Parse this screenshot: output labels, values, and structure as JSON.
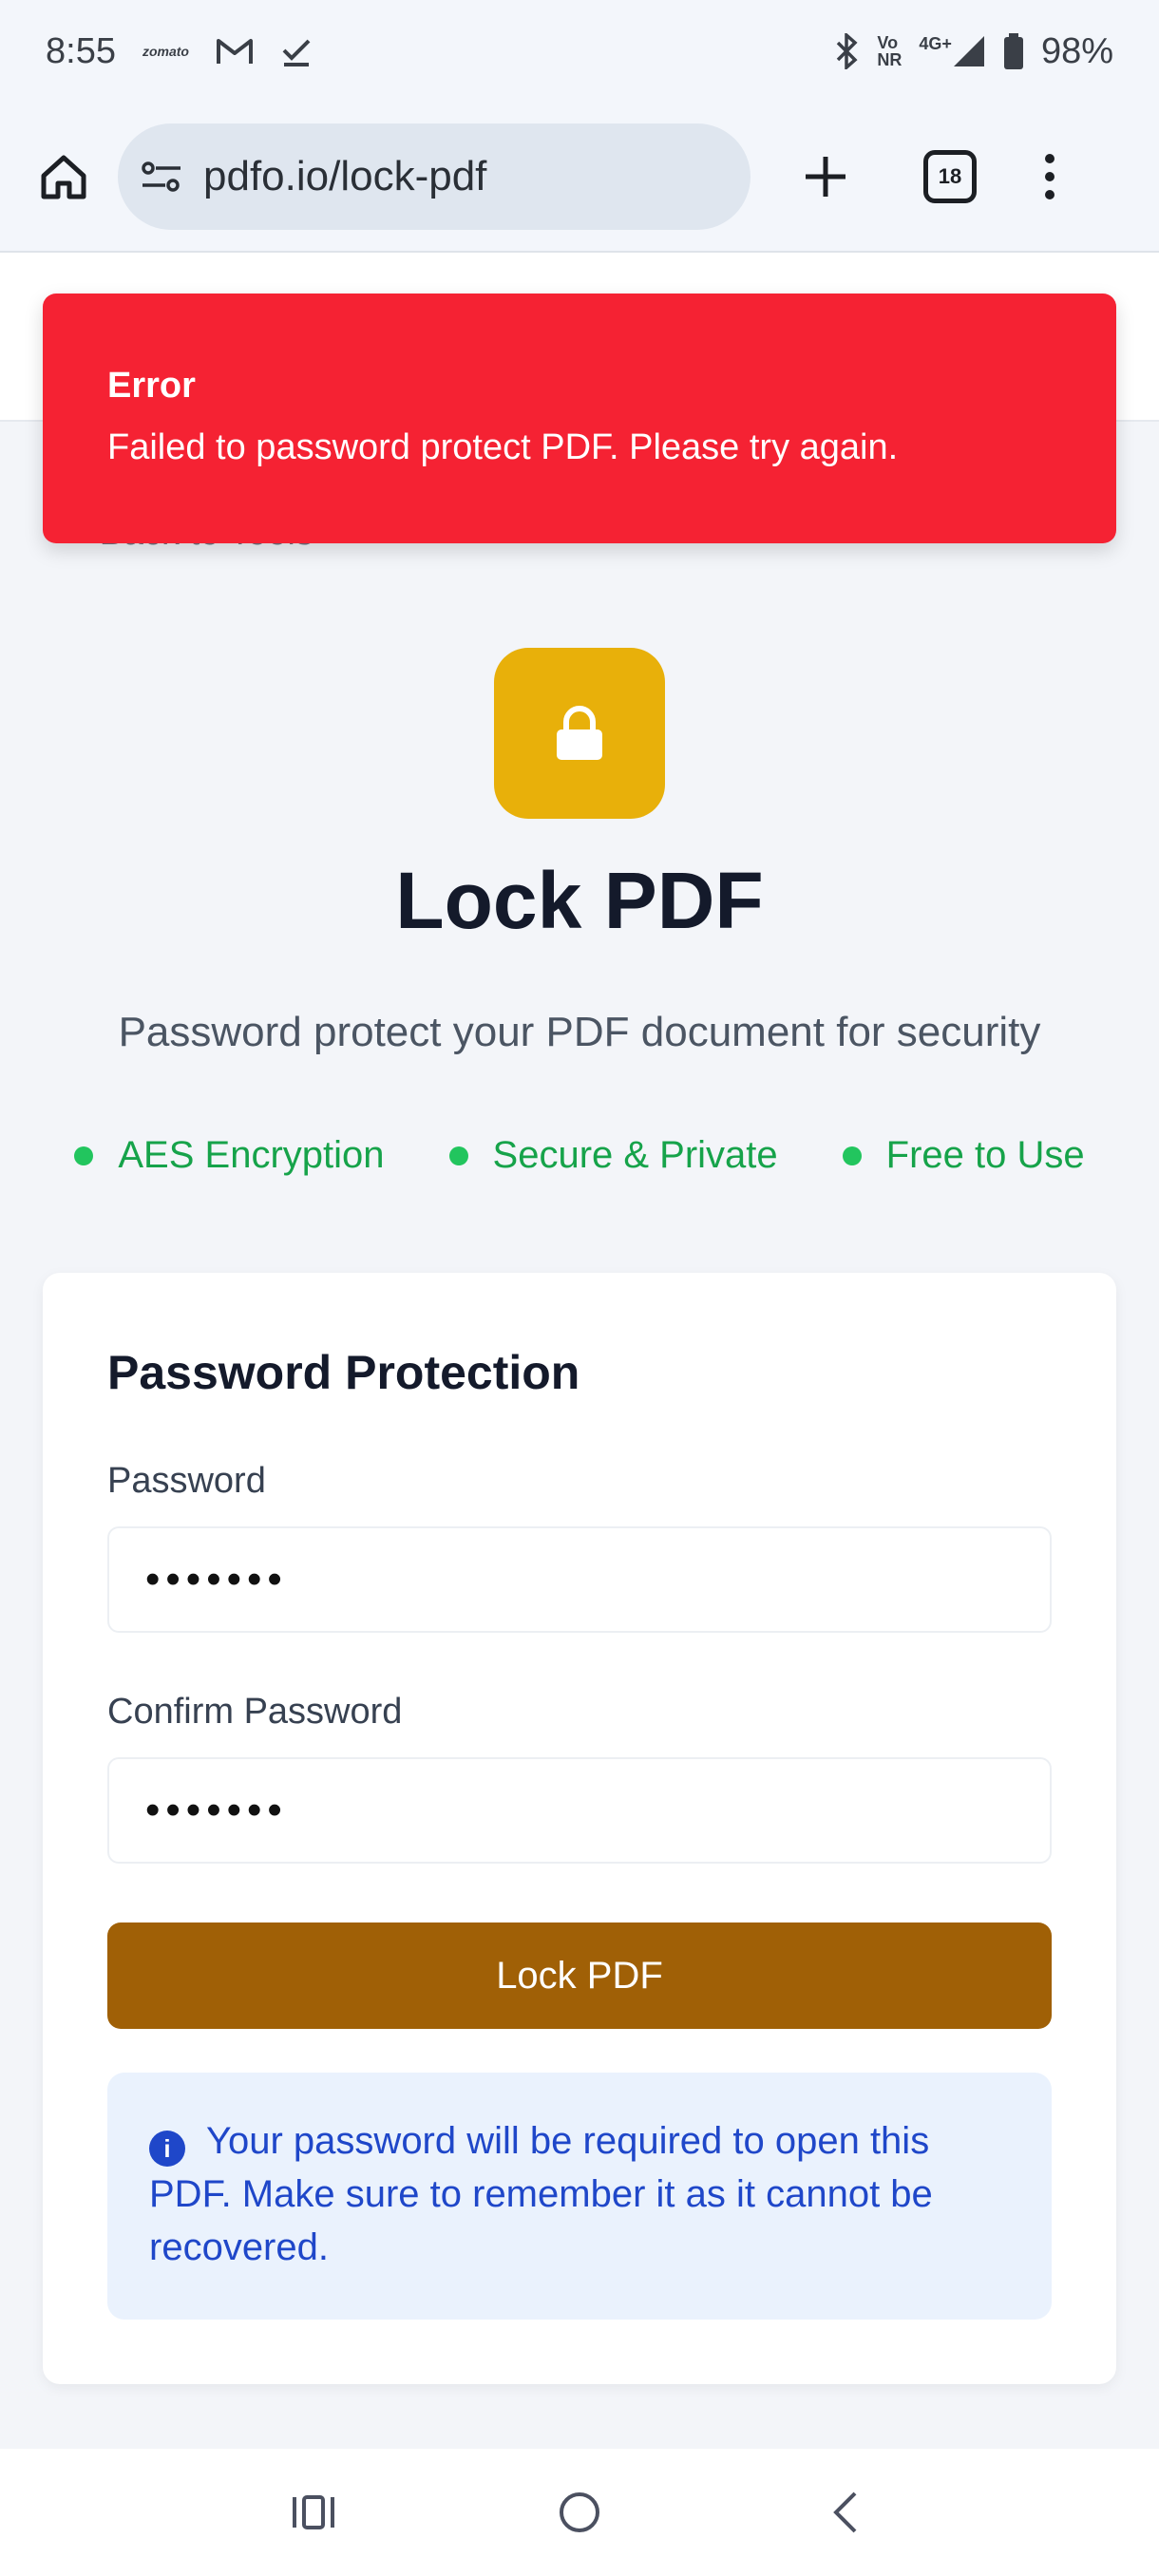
{
  "status_bar": {
    "time": "8:55",
    "app_label": "zomato",
    "network": [
      "Vo",
      "NR"
    ],
    "network_type": "4G+",
    "battery": "98%"
  },
  "browser": {
    "url": "pdfo.io/lock-pdf",
    "tab_count": "18"
  },
  "page": {
    "back_link": "Back to Tools"
  },
  "toast": {
    "title": "Error",
    "message": "Failed to password protect PDF. Please try again."
  },
  "hero": {
    "title": "Lock PDF",
    "subtitle": "Password protect your PDF document for security",
    "features": [
      "AES Encryption",
      "Secure & Private",
      "Free to Use"
    ]
  },
  "form": {
    "title": "Password Protection",
    "password_label": "Password",
    "password_value": "•••••••",
    "confirm_label": "Confirm Password",
    "confirm_value": "•••••••",
    "submit_label": "Lock PDF",
    "info_text": "Your password will be required to open this PDF. Make sure to remember it as it cannot be recovered."
  },
  "colors": {
    "error": "#f52233",
    "lock_tile": "#e8b00a",
    "button": "#a06006",
    "feature_green": "#16a34a",
    "info_blue": "#1f47c9"
  }
}
